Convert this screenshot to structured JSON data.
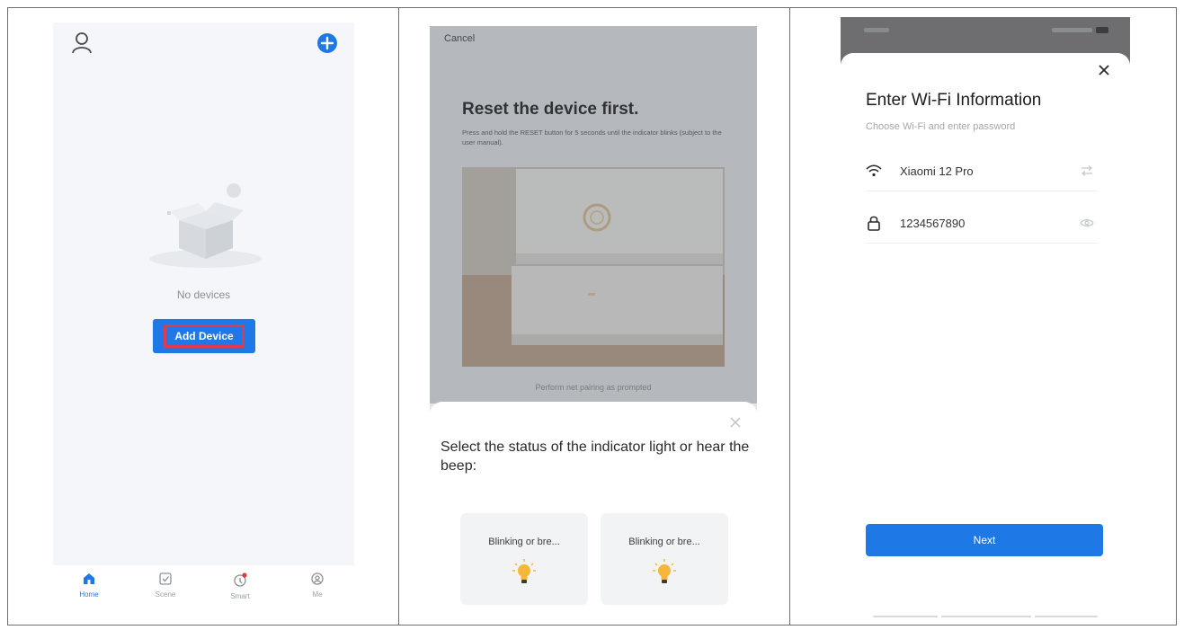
{
  "panel1": {
    "empty_label": "No devices",
    "add_device_label": "Add Device",
    "tabs": [
      {
        "label": "Home",
        "icon": "home-icon",
        "active": true
      },
      {
        "label": "Scene",
        "icon": "scene-icon",
        "active": false
      },
      {
        "label": "Smart",
        "icon": "smart-icon",
        "active": false
      },
      {
        "label": "Me",
        "icon": "me-icon",
        "active": false
      }
    ]
  },
  "panel2": {
    "cancel_label": "Cancel",
    "title": "Reset the device first.",
    "description": "Press and hold the RESET button for 5 seconds until the indicator blinks (subject to the user manual).",
    "pairing_hint": "Perform net pairing as prompted",
    "sheet_title": "Select the status of the indicator light or hear the beep:",
    "options": [
      {
        "label": "Blinking or bre..."
      },
      {
        "label": "Blinking or bre..."
      }
    ]
  },
  "panel3": {
    "title": "Enter Wi-Fi Information",
    "subtitle": "Choose Wi-Fi and enter password",
    "ssid": "Xiaomi 12 Pro",
    "password": "1234567890",
    "next_label": "Next"
  },
  "colors": {
    "accent": "#1e78e6",
    "highlight": "#e03a4f",
    "bulb": "#f4b73c"
  }
}
